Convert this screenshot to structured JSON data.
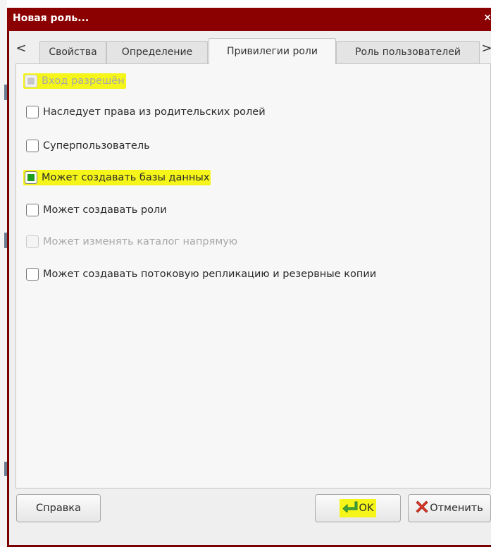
{
  "window": {
    "title": "Новая роль...",
    "close_glyph": "×"
  },
  "tabs": {
    "left_arrow": "<",
    "right_arrow": ">",
    "items": [
      {
        "label": "Свойства",
        "active": false
      },
      {
        "label": "Определение",
        "active": false
      },
      {
        "label": "Привилегии роли",
        "active": true
      },
      {
        "label": "Роль пользователей",
        "active": false
      }
    ]
  },
  "privileges": [
    {
      "label": "Вход разрешён",
      "checked": true,
      "disabled": true,
      "highlighted": true
    },
    {
      "label": "Наследует права из родительских ролей",
      "checked": false,
      "disabled": false,
      "highlighted": false
    },
    {
      "label": "Суперпользователь",
      "checked": false,
      "disabled": false,
      "highlighted": false
    },
    {
      "label": "Может создавать базы данных",
      "checked": true,
      "disabled": false,
      "highlighted": true
    },
    {
      "label": "Может создавать роли",
      "checked": false,
      "disabled": false,
      "highlighted": false
    },
    {
      "label": "Может изменять каталог напрямую",
      "checked": false,
      "disabled": true,
      "highlighted": false
    },
    {
      "label": "Может создавать потоковую репликацию и резервные копии",
      "checked": false,
      "disabled": false,
      "highlighted": false
    }
  ],
  "buttons": {
    "help": "Справка",
    "ok": "OK",
    "cancel": "Отменить"
  },
  "icons": {
    "ok": "enter-arrow-icon",
    "cancel": "red-x-icon"
  },
  "colors": {
    "titlebar": "#8b0000",
    "highlight": "#f5f51a",
    "checkbox_fill": "#1e9d1e"
  }
}
